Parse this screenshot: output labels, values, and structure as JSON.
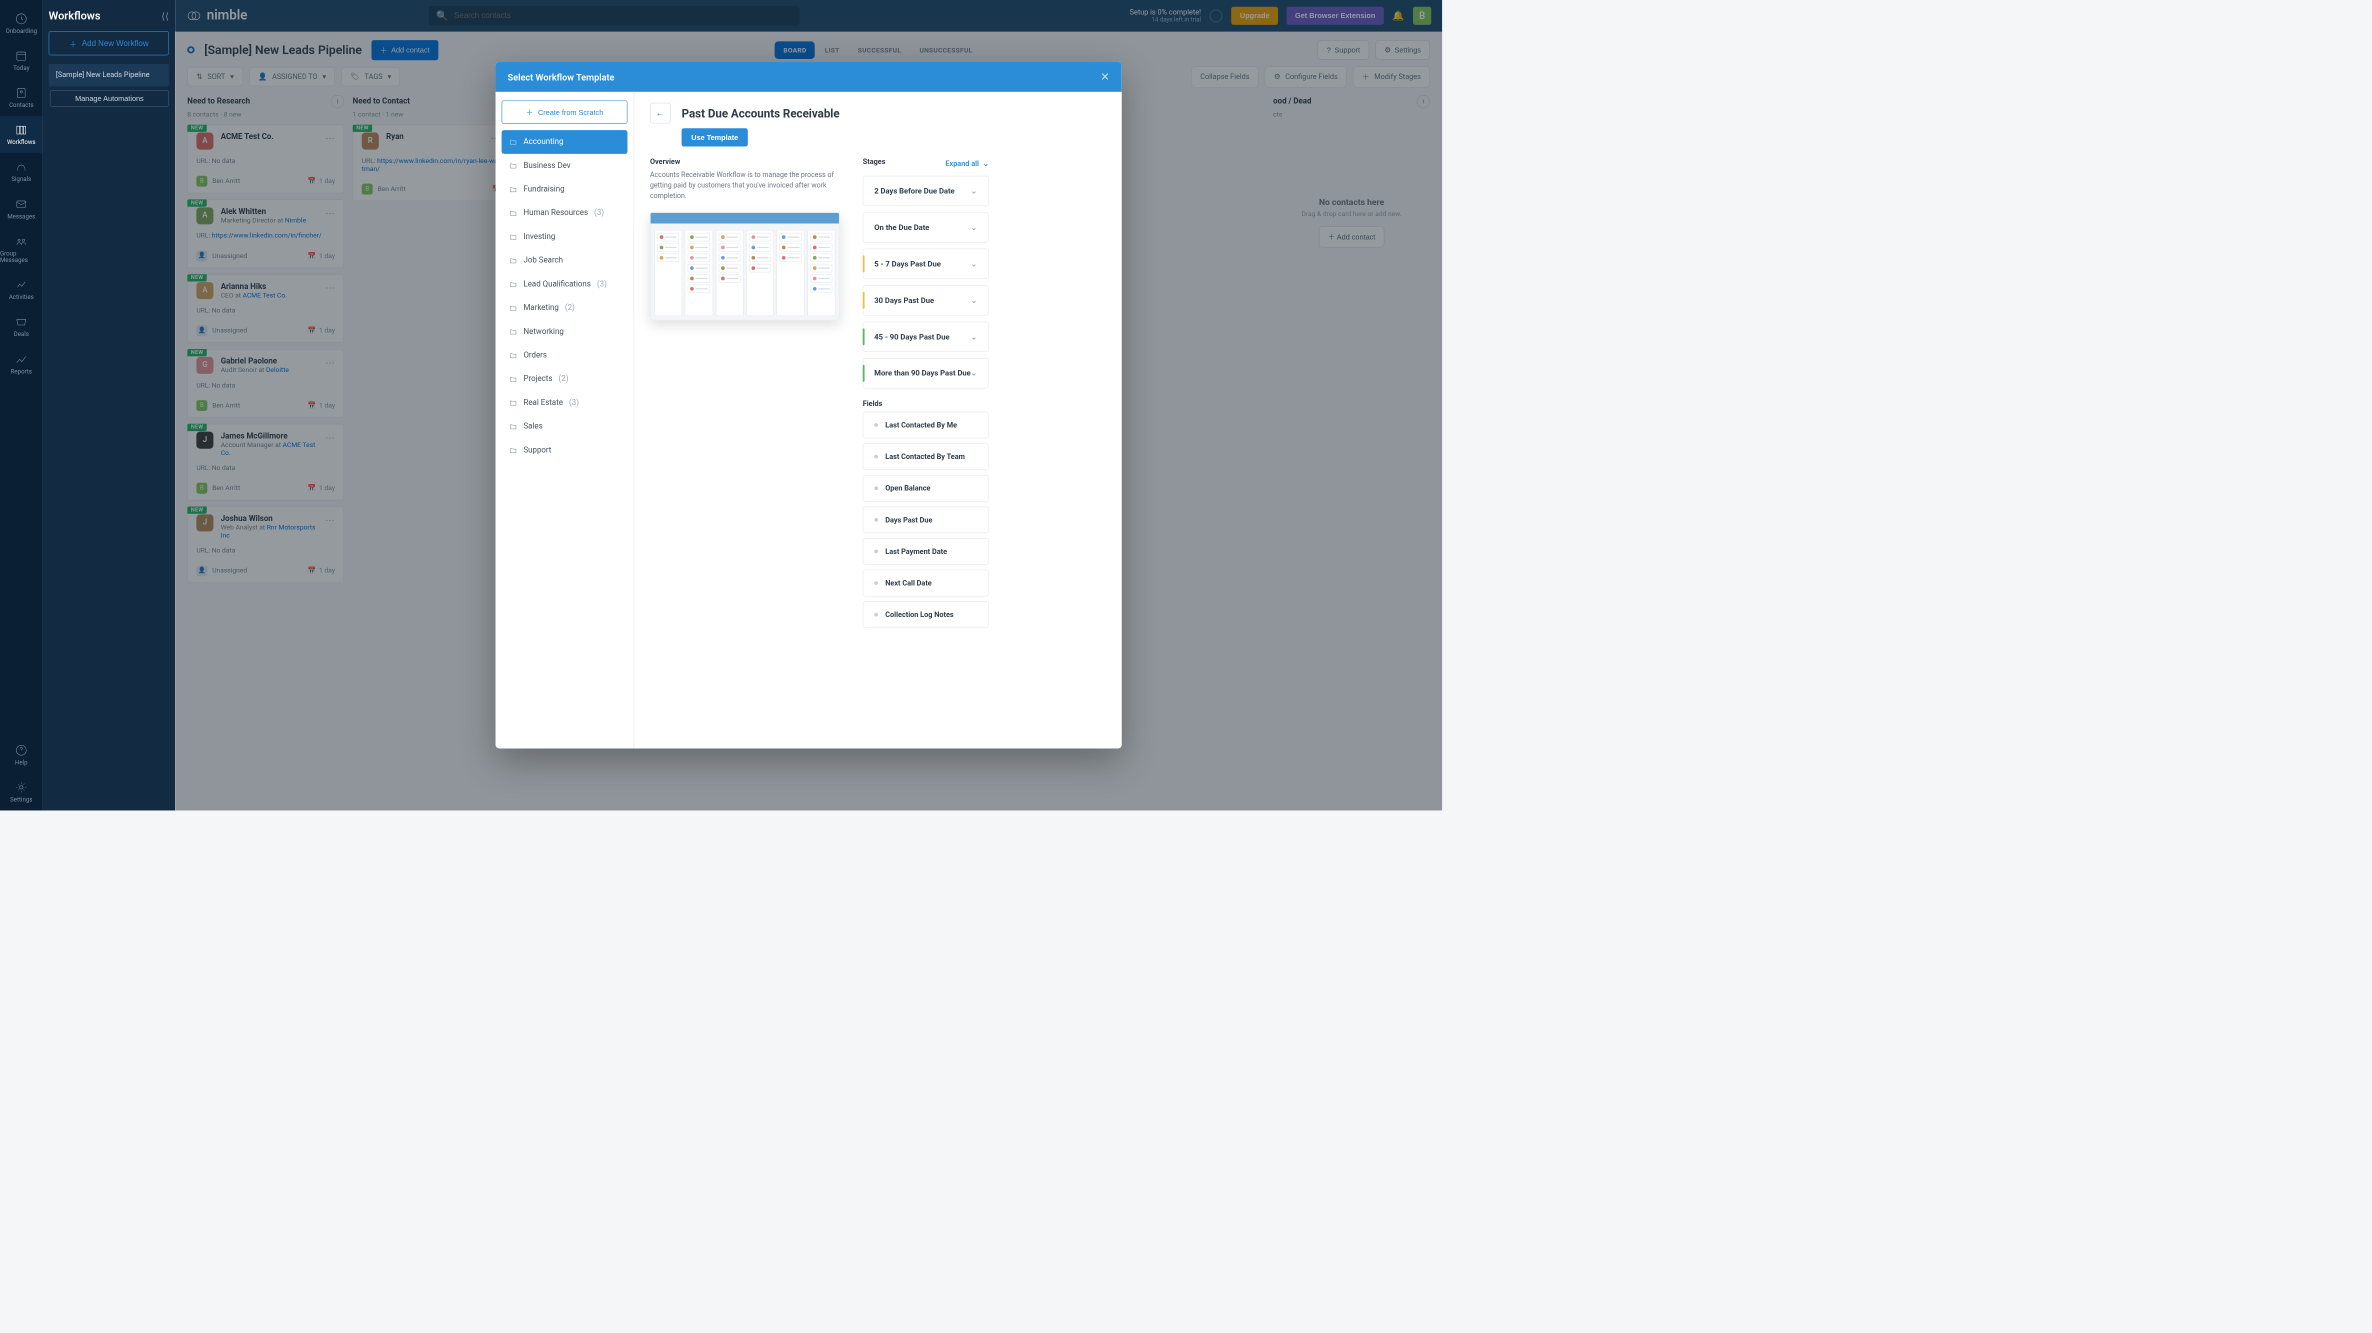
{
  "brand": "nimble",
  "search": {
    "placeholder": "Search contacts"
  },
  "setup": {
    "headline": "Setup is 0% complete!",
    "sub": "14 days left in trial"
  },
  "buttons": {
    "upgrade": "Upgrade",
    "getExt": "Get Browser Extension"
  },
  "avatarInitial": "B",
  "nav": {
    "items": [
      {
        "label": "Onboarding"
      },
      {
        "label": "Today"
      },
      {
        "label": "Contacts"
      },
      {
        "label": "Workflows"
      },
      {
        "label": "Signals"
      },
      {
        "label": "Messages"
      },
      {
        "label": "Group Messages"
      },
      {
        "label": "Activities"
      },
      {
        "label": "Deals"
      },
      {
        "label": "Reports"
      }
    ],
    "bottom": [
      {
        "label": "Help"
      },
      {
        "label": "Settings"
      }
    ]
  },
  "sidePanel": {
    "title": "Workflows",
    "addNew": "Add New Workflow",
    "activeWorkflow": "[Sample] New Leads Pipeline",
    "manageAutomations": "Manage Automations"
  },
  "workflowHeader": {
    "title": "[Sample] New Leads Pipeline",
    "addContact": "Add contact",
    "views": [
      "BOARD",
      "LIST",
      "SUCCESSFUL",
      "UNSUCCESSFUL"
    ],
    "support": "Support",
    "settings": "Settings"
  },
  "filters": {
    "sort": "SORT",
    "assigned": "ASSIGNED TO",
    "tags": "TAGS",
    "collapse": "Collapse Fields",
    "configure": "Configure Fields",
    "modify": "Modify Stages"
  },
  "columns": [
    {
      "title": "Need to Research",
      "sub": "8 contacts · 8 new",
      "cards": [
        {
          "new": true,
          "avatar": "A",
          "avatarColor": "#e06b6b",
          "name": "ACME Test Co.",
          "url": "No data",
          "assignee": "Ben Arritt",
          "assigneeColor": "#86c95f",
          "due": "1 day"
        },
        {
          "new": true,
          "avatar": "A",
          "avatarColor": "#7fa85a",
          "name": "Alek Whitten",
          "role": "Marketing Director at",
          "company": "Nimble",
          "companyLink": true,
          "urlLink": "https://www.linkedin.com/in/fincher/",
          "assignee": "Unassigned",
          "assigneeIcon": true,
          "due": "1 day"
        },
        {
          "new": true,
          "avatar": "A",
          "avatarColor": "#d2a562",
          "name": "Arianna Hiks",
          "role": "CEO at",
          "company": "ACME Test Co.",
          "companyLink": true,
          "url": "No data",
          "assignee": "Unassigned",
          "assigneeIcon": true,
          "due": "1 day"
        },
        {
          "new": true,
          "avatar": "G",
          "avatarColor": "#e4949c",
          "name": "Gabriel Paolone",
          "role": "Audit Senoir at",
          "company": "Deloitte",
          "companyLink": true,
          "url": "No data",
          "assignee": "Ben Arritt",
          "assigneeColor": "#86c95f",
          "due": "1 day"
        },
        {
          "new": true,
          "avatar": "J",
          "avatarColor": "#3b3b3b",
          "name": "James McGillmore",
          "role": "Account Manager at",
          "company": "ACME Test Co.",
          "companyLink": true,
          "url": "No data",
          "assignee": "Ben Arritt",
          "assigneeColor": "#86c95f",
          "due": "1 day"
        },
        {
          "new": true,
          "avatar": "J",
          "avatarColor": "#b38b5a",
          "name": "Joshua Wilson",
          "role": "Web Analyst at",
          "company": "Rnr Motorsports Inc",
          "companyLink": true,
          "url": "No data",
          "assignee": "Unassigned",
          "assigneeIcon": true,
          "due": "1 day"
        }
      ]
    },
    {
      "title": "Need to Contact",
      "sub": "1 contact · 1 new",
      "cards": [
        {
          "new": true,
          "avatar": "R",
          "avatarColor": "#c0865a",
          "avatarImg": true,
          "name": "Ryan",
          "urlLink": "https://www.linkedin.com/in/ryan-lee-waltman/",
          "urlPrefix": "URL",
          "assignee": "Ben Arritt",
          "assigneeColor": "#86c95f",
          "due": ""
        }
      ]
    },
    {
      "title": "",
      "sub": "",
      "cards": []
    },
    {
      "title": "ood / Dead",
      "sub": "cts",
      "empty": true,
      "emptyTitle": "No contacts here",
      "emptySub": "Drag & drop card here or add new.",
      "emptyBtn": "Add contact"
    }
  ],
  "modal": {
    "title": "Select Workflow Template",
    "createFromScratch": "Create from Scratch",
    "categories": [
      {
        "label": "Accounting",
        "active": true
      },
      {
        "label": "Business Dev"
      },
      {
        "label": "Fundraising"
      },
      {
        "label": "Human Resources",
        "count": "(3)"
      },
      {
        "label": "Investing"
      },
      {
        "label": "Job Search"
      },
      {
        "label": "Lead Qualifications",
        "count": "(3)"
      },
      {
        "label": "Marketing",
        "count": "(2)"
      },
      {
        "label": "Networking"
      },
      {
        "label": "Orders"
      },
      {
        "label": "Projects",
        "count": "(2)"
      },
      {
        "label": "Real Estate",
        "count": "(3)"
      },
      {
        "label": "Sales"
      },
      {
        "label": "Support"
      }
    ],
    "detail": {
      "title": "Past Due Accounts Receivable",
      "useTemplate": "Use Template",
      "overviewLabel": "Overview",
      "overviewText": "Accounts Receivable Workflow is to manage the process of getting paid by customers that you've invoiced after work completion.",
      "stagesLabel": "Stages",
      "expandAll": "Expand all",
      "stages": [
        {
          "label": "2 Days Before Due Date",
          "accent": ""
        },
        {
          "label": "On the Due Date",
          "accent": ""
        },
        {
          "label": "5 - 7 Days Past Due",
          "accent": "#e0c94b"
        },
        {
          "label": "30 Days Past Due",
          "accent": "#e0c94b"
        },
        {
          "label": "45 - 90 Days Past Due",
          "accent": "#5fb36b"
        },
        {
          "label": "More than 90 Days Past Due",
          "accent": "#5fb36b"
        }
      ],
      "fieldsLabel": "Fields",
      "fields": [
        "Last Contacted By Me",
        "Last Contacted By Team",
        "Open Balance",
        "Days Past Due",
        "Last Payment Date",
        "Next Call Date",
        "Collection Log Notes"
      ]
    }
  }
}
